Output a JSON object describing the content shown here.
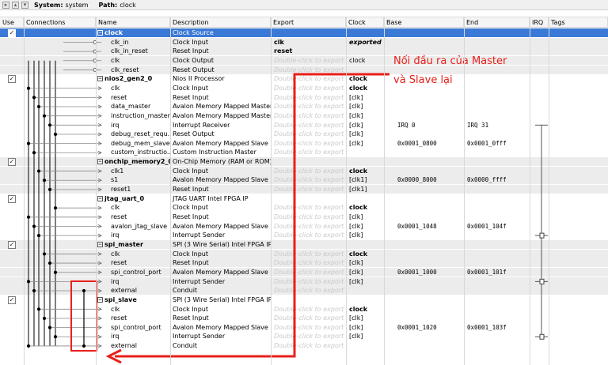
{
  "toolbar": {
    "system_label": "System:",
    "system_value": "system",
    "path_label": "Path:",
    "path_value": "clock"
  },
  "columns": [
    "Use",
    "Connections",
    "Name",
    "Description",
    "Export",
    "Clock",
    "Base",
    "End",
    "IRQ",
    "Tags"
  ],
  "rows": [
    {
      "kind": "component",
      "use": true,
      "name": "clock",
      "desc": "Clock Source",
      "export": "",
      "clock": "",
      "base": "",
      "end": "",
      "selected": true
    },
    {
      "kind": "port",
      "name": "clk_in",
      "desc": "Clock Input",
      "export": "clk",
      "export_style": "bold",
      "clock": "exported",
      "clock_style": "bolditalic"
    },
    {
      "kind": "port",
      "name": "clk_in_reset",
      "desc": "Reset Input",
      "export": "reset",
      "export_style": "bold",
      "clock": ""
    },
    {
      "kind": "port",
      "name": "clk",
      "desc": "Clock Output",
      "export": "Double-click to export",
      "export_style": "ghost",
      "clock": "clock"
    },
    {
      "kind": "port",
      "name": "clk_reset",
      "desc": "Reset Output",
      "export": "Double-click to export",
      "export_style": "ghost",
      "clock": ""
    },
    {
      "kind": "component",
      "use": true,
      "name": "nios2_gen2_0",
      "desc": "Nios II Processor",
      "export": "Double-click to export",
      "export_style": "ghost",
      "clock": "clock",
      "clock_style": "bold"
    },
    {
      "kind": "port",
      "name": "clk",
      "desc": "Clock Input",
      "export": "Double-click to export",
      "export_style": "ghost",
      "clock": "clock",
      "clock_style": "bold"
    },
    {
      "kind": "port",
      "name": "reset",
      "desc": "Reset Input",
      "export": "Double-click to export",
      "export_style": "ghost",
      "clock": "[clk]"
    },
    {
      "kind": "port",
      "name": "data_master",
      "desc": "Avalon Memory Mapped Master",
      "export": "Double-click to export",
      "export_style": "ghost",
      "clock": "[clk]"
    },
    {
      "kind": "port",
      "name": "instruction_master",
      "desc": "Avalon Memory Mapped Master",
      "export": "Double-click to export",
      "export_style": "ghost",
      "clock": "[clk]"
    },
    {
      "kind": "port",
      "name": "irq",
      "desc": "Interrupt Receiver",
      "export": "Double-click to export",
      "export_style": "ghost",
      "clock": "[clk]",
      "base": "IRQ 0",
      "end": "IRQ 31"
    },
    {
      "kind": "port",
      "name": "debug_reset_requ...",
      "desc": "Reset Output",
      "export": "Double-click to export",
      "export_style": "ghost",
      "clock": "[clk]"
    },
    {
      "kind": "port",
      "name": "debug_mem_slave",
      "desc": "Avalon Memory Mapped Slave",
      "export": "Double-click to export",
      "export_style": "ghost",
      "clock": "[clk]",
      "base": "0x0001_0800",
      "end": "0x0001_0fff"
    },
    {
      "kind": "port",
      "name": "custom_instructio...",
      "desc": "Custom Instruction Master",
      "export": "Double-click to export",
      "export_style": "ghost",
      "clock": ""
    },
    {
      "kind": "component",
      "use": true,
      "name": "onchip_memory2_0",
      "desc": "On-Chip Memory (RAM or ROM)...",
      "export": "",
      "clock": ""
    },
    {
      "kind": "port",
      "name": "clk1",
      "desc": "Clock Input",
      "export": "Double-click to export",
      "export_style": "ghost",
      "clock": "clock",
      "clock_style": "bold"
    },
    {
      "kind": "port",
      "name": "s1",
      "desc": "Avalon Memory Mapped Slave",
      "export": "Double-click to export",
      "export_style": "ghost",
      "clock": "[clk1]",
      "base": "0x0000_8000",
      "end": "0x0000_ffff"
    },
    {
      "kind": "port",
      "name": "reset1",
      "desc": "Reset Input",
      "export": "Double-click to export",
      "export_style": "ghost",
      "clock": "[clk1]"
    },
    {
      "kind": "component",
      "use": true,
      "name": "jtag_uart_0",
      "desc": "JTAG UART Intel FPGA IP",
      "export": "",
      "clock": ""
    },
    {
      "kind": "port",
      "name": "clk",
      "desc": "Clock Input",
      "export": "Double-click to export",
      "export_style": "ghost",
      "clock": "clock",
      "clock_style": "bold"
    },
    {
      "kind": "port",
      "name": "reset",
      "desc": "Reset Input",
      "export": "Double-click to export",
      "export_style": "ghost",
      "clock": "[clk]"
    },
    {
      "kind": "port",
      "name": "avalon_jtag_slave",
      "desc": "Avalon Memory Mapped Slave",
      "export": "Double-click to export",
      "export_style": "ghost",
      "clock": "[clk]",
      "base": "0x0001_1048",
      "end": "0x0001_104f"
    },
    {
      "kind": "port",
      "name": "irq",
      "desc": "Interrupt Sender",
      "export": "Double-click to export",
      "export_style": "ghost",
      "clock": "[clk]"
    },
    {
      "kind": "component",
      "use": true,
      "name": "spi_master",
      "desc": "SPI (3 Wire Serial) Intel FPGA IP",
      "export": "",
      "clock": ""
    },
    {
      "kind": "port",
      "name": "clk",
      "desc": "Clock Input",
      "export": "Double-click to export",
      "export_style": "ghost",
      "clock": "clock",
      "clock_style": "bold"
    },
    {
      "kind": "port",
      "name": "reset",
      "desc": "Reset Input",
      "export": "Double-click to export",
      "export_style": "ghost",
      "clock": "[clk]"
    },
    {
      "kind": "port",
      "name": "spi_control_port",
      "desc": "Avalon Memory Mapped Slave",
      "export": "Double-click to export",
      "export_style": "ghost",
      "clock": "[clk]",
      "base": "0x0001_1000",
      "end": "0x0001_101f"
    },
    {
      "kind": "port",
      "name": "irq",
      "desc": "Interrupt Sender",
      "export": "Double-click to export",
      "export_style": "ghost",
      "clock": "[clk]"
    },
    {
      "kind": "port",
      "name": "external",
      "desc": "Conduit",
      "export": "Double-click to export",
      "export_style": "ghost",
      "clock": ""
    },
    {
      "kind": "component",
      "use": true,
      "name": "spi_slave",
      "desc": "SPI (3 Wire Serial) Intel FPGA IP",
      "export": "",
      "clock": ""
    },
    {
      "kind": "port",
      "name": "clk",
      "desc": "Clock Input",
      "export": "Double-click to export",
      "export_style": "ghost",
      "clock": "clock",
      "clock_style": "bold"
    },
    {
      "kind": "port",
      "name": "reset",
      "desc": "Reset Input",
      "export": "Double-click to export",
      "export_style": "ghost",
      "clock": "[clk]"
    },
    {
      "kind": "port",
      "name": "spi_control_port",
      "desc": "Avalon Memory Mapped Slave",
      "export": "Double-click to export",
      "export_style": "ghost",
      "clock": "[clk]",
      "base": "0x0001_1020",
      "end": "0x0001_103f"
    },
    {
      "kind": "port",
      "name": "irq",
      "desc": "Interrupt Sender",
      "export": "Double-click to export",
      "export_style": "ghost",
      "clock": "[clk]"
    },
    {
      "kind": "port",
      "name": "external",
      "desc": "Conduit",
      "export": "Double-click to export",
      "export_style": "ghost",
      "clock": ""
    }
  ],
  "annotation": {
    "line1": "Nối đầu ra của Master",
    "line2": "và Slave lại",
    "color": "#e8201b"
  },
  "colors": {
    "selection": "#3b79d6",
    "alt_row": "#ececec",
    "annotation": "#e8201b"
  }
}
